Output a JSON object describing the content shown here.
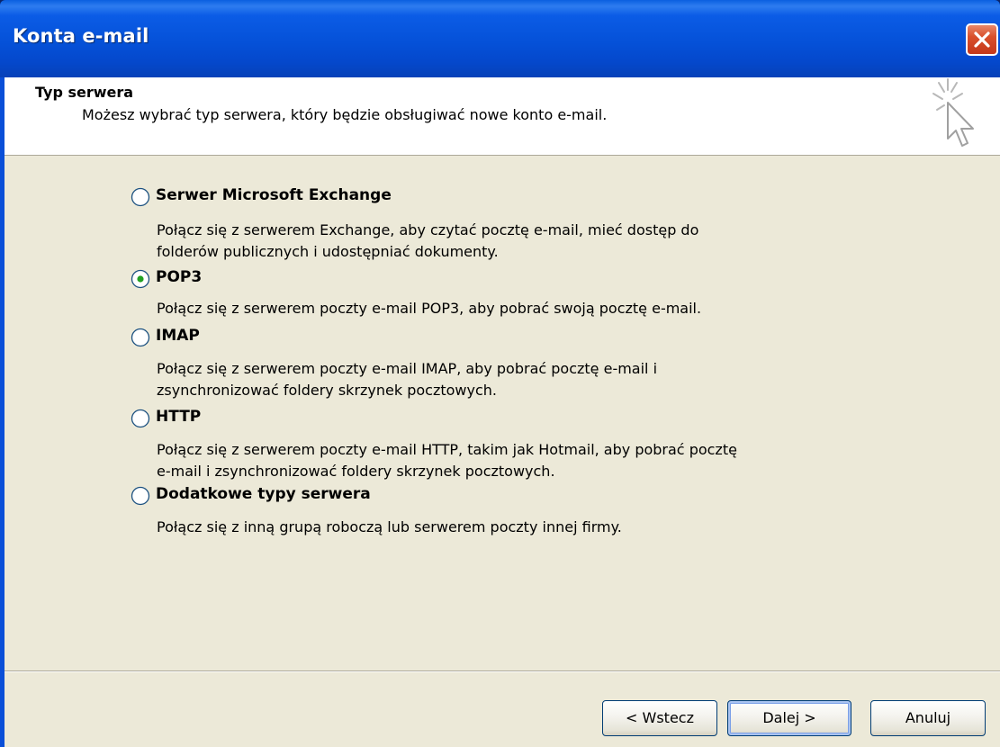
{
  "window": {
    "title": "Konta e-mail"
  },
  "header": {
    "title": "Typ serwera",
    "description": "Możesz wybrać typ serwera, który będzie obsługiwać nowe konto e-mail."
  },
  "options": [
    {
      "label": "Serwer Microsoft Exchange",
      "selected": false,
      "description_lines": [
        "Połącz się z serwerem Exchange, aby czytać pocztę e-mail, mieć dostęp do",
        "folderów publicznych i udostępniać dokumenty."
      ]
    },
    {
      "label": "POP3",
      "selected": true,
      "description_lines": [
        "Połącz się z serwerem poczty e-mail POP3, aby pobrać swoją pocztę e-mail."
      ]
    },
    {
      "label": "IMAP",
      "selected": false,
      "description_lines": [
        "Połącz się z serwerem poczty e-mail IMAP, aby pobrać pocztę e-mail i",
        "zsynchronizować foldery skrzynek pocztowych."
      ]
    },
    {
      "label": "HTTP",
      "selected": false,
      "description_lines": [
        "Połącz się z serwerem poczty e-mail HTTP, takim jak Hotmail, aby pobrać pocztę",
        "e-mail i zsynchronizować foldery skrzynek pocztowych."
      ]
    },
    {
      "label": "Dodatkowe typy serwera",
      "selected": false,
      "description_lines": [
        "Połącz się z inną grupą roboczą lub serwerem poczty innej firmy."
      ]
    }
  ],
  "buttons": {
    "back": "< Wstecz",
    "next": "Dalej >",
    "cancel": "Anuluj"
  },
  "icons": {
    "close": "close-icon",
    "wizard": "wizard-cursor-icon",
    "radio": "radio-button-icon"
  },
  "colors": {
    "titlebar": "#0551d8",
    "body": "#ece9d8",
    "close": "#d9502c"
  }
}
